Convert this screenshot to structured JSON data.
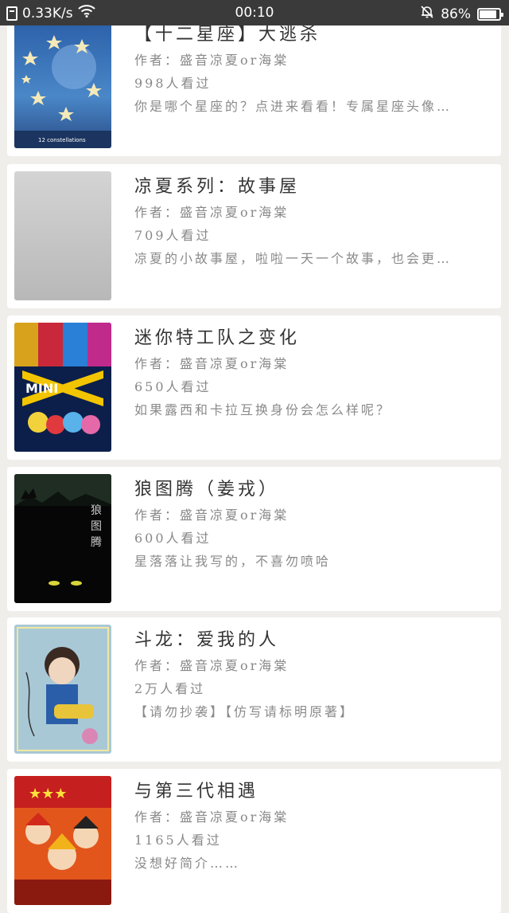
{
  "status_bar": {
    "speed": "0.33K/s",
    "time": "00:10",
    "battery": "86%",
    "battery_level": 0.86,
    "icons": [
      "document-icon",
      "wifi-icon",
      "mute-bell-icon",
      "battery-icon"
    ]
  },
  "books": [
    {
      "title": "【十二星座】大逃杀",
      "author": "作者：盛音凉夏or海棠",
      "views": "998人看过",
      "desc": "你是哪个星座的？点进来看看！专属星座头像…",
      "cover_icon": "starry-constellation-cover"
    },
    {
      "title": "凉夏系列：故事屋",
      "author": "作者：盛音凉夏or海棠",
      "views": "709人看过",
      "desc": "凉夏的小故事屋，啦啦一天一个故事，也会更…",
      "cover_icon": "blank-gray-cover"
    },
    {
      "title": "迷你特工队之变化",
      "author": "作者：盛音凉夏or海棠",
      "views": "650人看过",
      "desc": "如果露西和卡拉互换身份会怎么样呢？",
      "cover_icon": "mini-force-cover"
    },
    {
      "title": "狼图腾（姜戎）",
      "author": "作者：盛音凉夏or海棠",
      "views": "600人看过",
      "desc": "星落落让我写的，不喜勿喷哈",
      "cover_icon": "wolf-totem-cover"
    },
    {
      "title": "斗龙：爱我的人",
      "author": "作者：盛音凉夏or海棠",
      "views": "2万人看过",
      "desc": "【请勿抄袭】【仿写请标明原著】",
      "cover_icon": "dragon-warrior-cover"
    },
    {
      "title": "与第三代相遇",
      "author": "作者：盛音凉夏or海棠",
      "views": "1165人看过",
      "desc": "没想好简介……",
      "cover_icon": "anime-team-cover"
    }
  ],
  "colors": {
    "background": "#efeeea",
    "card": "#ffffff",
    "title": "#333333",
    "meta": "#888888",
    "status_bar": "#3a3a3a"
  }
}
